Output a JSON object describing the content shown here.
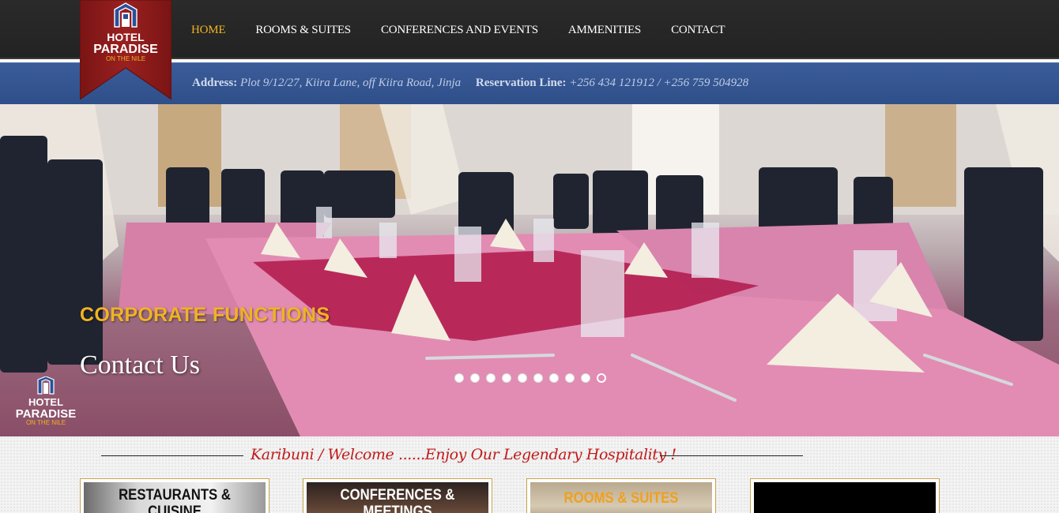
{
  "header": {
    "logo": {
      "line1": "HOTEL",
      "line2": "PARADISE",
      "line3": "ON THE NILE",
      "monogram": "HP"
    },
    "nav": [
      {
        "label": "HOME",
        "active": true
      },
      {
        "label": "ROOMS & SUITES",
        "active": false
      },
      {
        "label": "CONFERENCES AND EVENTS",
        "active": false
      },
      {
        "label": "AMMENITIES",
        "active": false
      },
      {
        "label": "CONTACT",
        "active": false
      }
    ]
  },
  "address_bar": {
    "address_label": "Address:",
    "address_value": "Plot 9/12/27, Kiira Lane, off Kiira Road, Jinja",
    "reservation_label": "Reservation Line:",
    "reservation_value": "+256 434 121912 / +256 759 504928"
  },
  "hero": {
    "title": "CORPORATE FUNCTIONS",
    "link": "Contact Us",
    "slides_total": 10,
    "active_slide": 10,
    "watermark": {
      "line1": "HOTEL",
      "line2": "PARADISE",
      "line3": "ON THE NILE"
    }
  },
  "welcome": {
    "text": "Karibuni /  Welcome ......Enjoy Our Legendary Hospitality !"
  },
  "cards": [
    {
      "label_line1": "RESTAURANTS &",
      "label_line2": "CUISINE",
      "color": "#111111"
    },
    {
      "label_line1": "CONFERENCES &",
      "label_line2": "MEETINGS",
      "color": "#ffffff"
    },
    {
      "label_line1": "ROOMS & SUITES",
      "label_line2": "",
      "color": "#f0a020"
    },
    {
      "label_line1": "",
      "label_line2": "",
      "color": "#000000"
    }
  ],
  "colors": {
    "accent": "#f0b323",
    "nav_bg": "#262626",
    "address_bg": "#35558f",
    "logo_red": "#8e1a1a",
    "welcome_red": "#c01a1a"
  }
}
